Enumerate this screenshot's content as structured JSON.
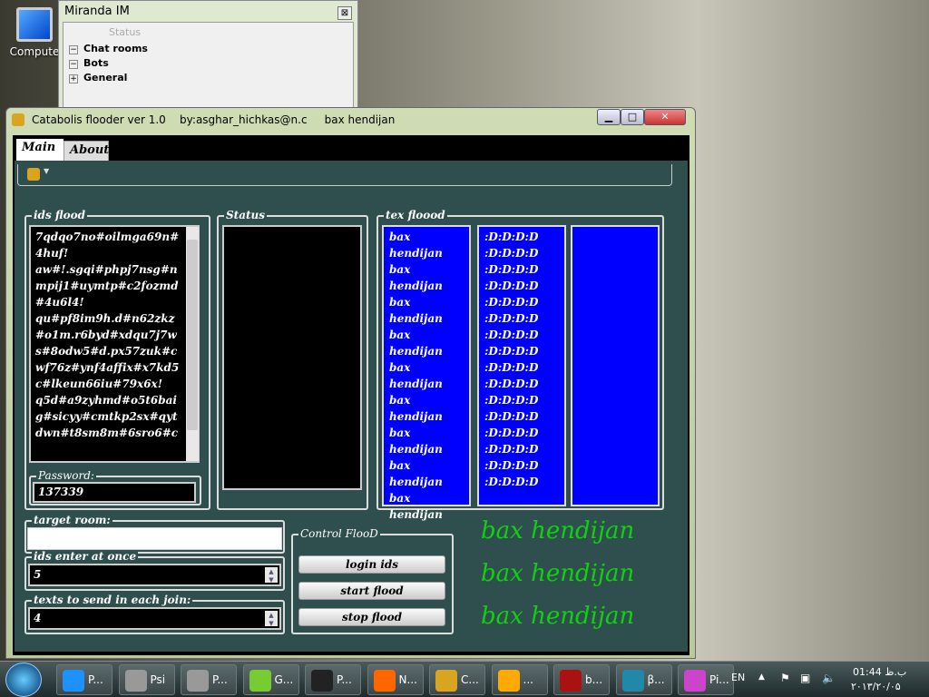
{
  "desktop": {
    "icon_label": "Compute"
  },
  "miranda": {
    "title": "Miranda IM",
    "close": "⊠",
    "status": "Status",
    "groups": [
      {
        "label": "Chat rooms",
        "state": "−"
      },
      {
        "label": "Bots",
        "state": "−"
      },
      {
        "label": "General",
        "state": "+"
      }
    ]
  },
  "window": {
    "title": "Catabolis flooder ver 1.0    by:asghar_hichkas@n.c     bax hendijan",
    "min": "▁",
    "max": "□",
    "close": "✕",
    "tabs": [
      "Main",
      "About"
    ],
    "ids_flood": {
      "label": "ids flood",
      "text": "7qdqo7no#oilmga69n#4huf!\naw#!.sgqi#phpj7nsg#nmpij1#uymtp#c2fozmd#4u6l4!\nqu#pf8im9h.d#n62zkz#o1m.r6byd#xdqu7j7ws#8odw5#d.px57zuk#cwf76z#ynf4affix#x7kd5c#lkeun66iu#79x6x!\nq5d#a9zyhmd#o5t6baig#sicyy#cmtkp2sx#qytdwn#t8sm8m#6sro6#c"
    },
    "password": {
      "label": "Password:",
      "value": "137339"
    },
    "status": {
      "label": "Status"
    },
    "tex_flood": {
      "label": "tex floood",
      "list1": [
        "bax hendijan",
        "bax hendijan",
        "bax hendijan",
        "bax hendijan",
        "bax hendijan",
        "bax hendijan",
        "bax hendijan",
        "bax hendijan",
        "bax hendijan"
      ],
      "list2": [
        ":D:D:D:D",
        ":D:D:D:D",
        ":D:D:D:D",
        ":D:D:D:D",
        ":D:D:D:D",
        ":D:D:D:D",
        ":D:D:D:D",
        ":D:D:D:D",
        ":D:D:D:D",
        ":D:D:D:D",
        ":D:D:D:D",
        ":D:D:D:D",
        ":D:D:D:D",
        ":D:D:D:D",
        ":D:D:D:D",
        ":D:D:D:D"
      ]
    },
    "target_room": {
      "label": "target room:",
      "value": ""
    },
    "ids_enter": {
      "label": "ids enter at once",
      "value": "5"
    },
    "texts_send": {
      "label": "texts to send in each join:",
      "value": "4"
    },
    "control": {
      "label": "Control FlooD",
      "login": "login ids",
      "start": "start flood",
      "stop": "stop flood"
    },
    "banner": [
      "bax hendijan",
      "bax hendijan",
      "bax hendijan"
    ]
  },
  "taskbar": {
    "items": [
      "P...",
      "Psi",
      "P...",
      "G...",
      "P...",
      "N...",
      "C...",
      "...",
      "b...",
      "β...",
      "Pi..."
    ],
    "lang": "EN",
    "time": "01:44 ب.ظ",
    "date": "۲۰۱۳/۲۰/۰۵"
  },
  "colors": {
    "panel": "#2f4f4f",
    "list_bg": "#0000ff",
    "banner": "#10d010"
  }
}
